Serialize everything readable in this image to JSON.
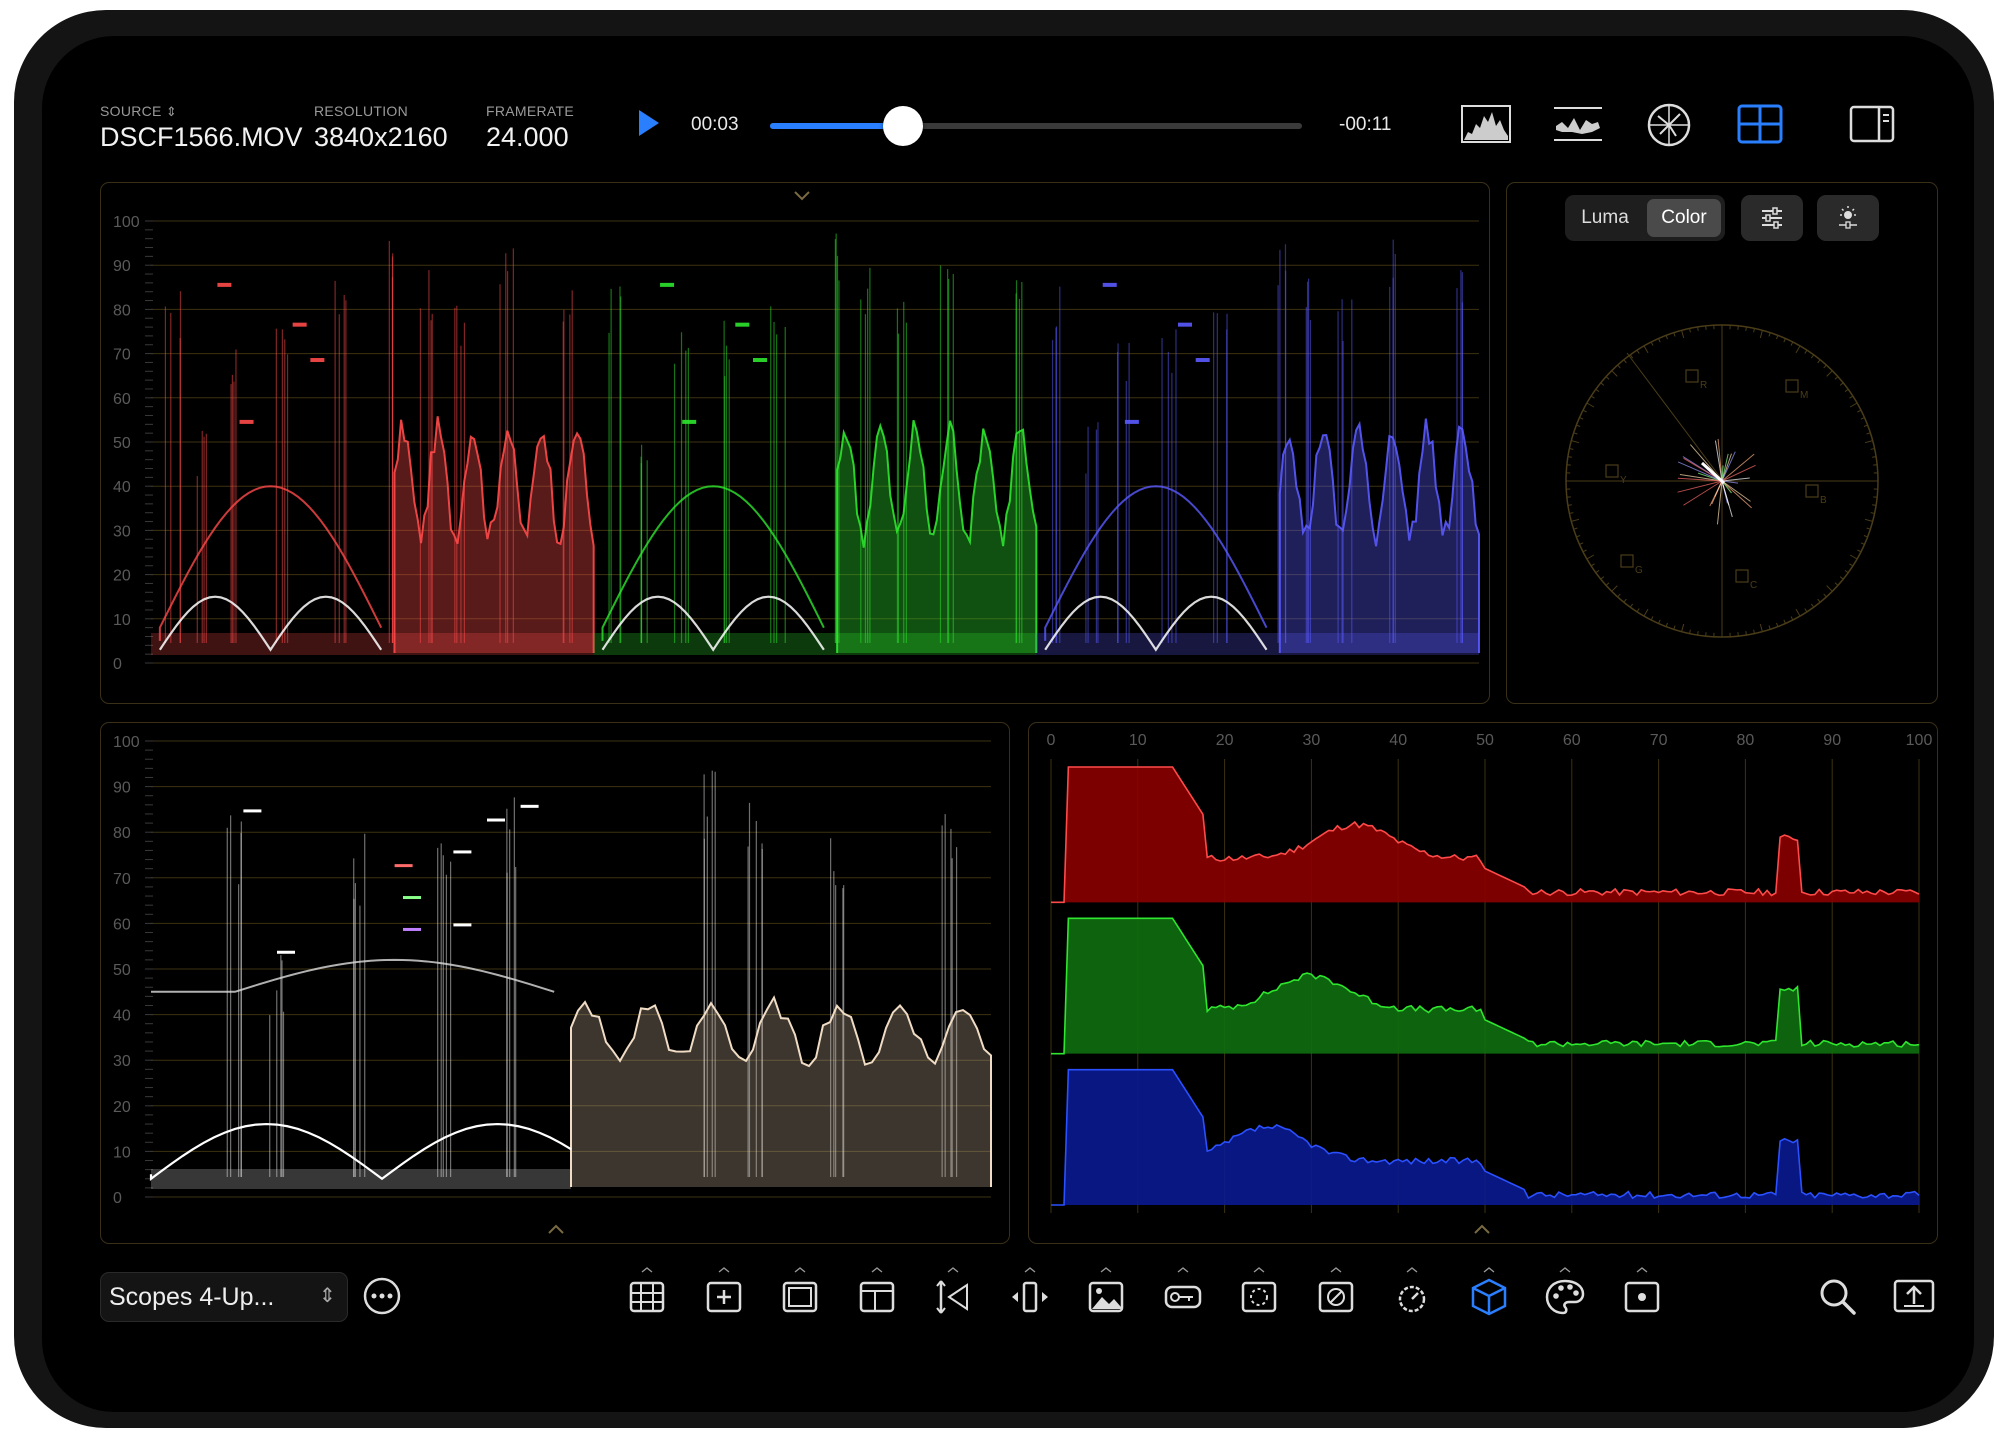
{
  "header": {
    "source_label": "SOURCE",
    "source_value": "DSCF1566.MOV",
    "resolution_label": "RESOLUTION",
    "resolution_value": "3840x2160",
    "framerate_label": "FRAMERATE",
    "framerate_value": "24.000",
    "time_elapsed": "00:03",
    "time_remaining": "-00:11",
    "playback_progress": 0.25
  },
  "colors": {
    "accent": "#2a7fff",
    "panel_border": "#3a3018",
    "grid_line": "#3d3210",
    "red": "#ff4a4a",
    "green": "#2ee62e",
    "blue": "#5a5aff"
  },
  "header_icons": [
    "histogram-icon",
    "waveform-icon",
    "vectorscope-icon",
    "grid-layout-icon",
    "sidebar-icon"
  ],
  "parade": {
    "y_ticks": [
      "100",
      "90",
      "80",
      "70",
      "60",
      "50",
      "40",
      "30",
      "20",
      "10",
      "0"
    ]
  },
  "vectorscope": {
    "mode_luma": "Luma",
    "mode_color": "Color",
    "selected_mode": "Color",
    "targets": [
      "R",
      "M",
      "B",
      "C",
      "G",
      "Y"
    ]
  },
  "luma_waveform": {
    "y_ticks": [
      "100",
      "90",
      "80",
      "70",
      "60",
      "50",
      "40",
      "30",
      "20",
      "10",
      "0"
    ]
  },
  "histogram": {
    "x_ticks": [
      "0",
      "10",
      "20",
      "30",
      "40",
      "50",
      "60",
      "70",
      "80",
      "90",
      "100"
    ]
  },
  "footer": {
    "preset_label": "Scopes 4-Up...",
    "tools": [
      "grid-icon",
      "crosshair-box-icon",
      "frame-icon",
      "layout-icon",
      "split-compare-icon",
      "mirror-icon",
      "image-icon",
      "key-icon",
      "mask-icon",
      "disable-icon",
      "timer-icon",
      "cube-icon",
      "palette-icon",
      "target-icon"
    ],
    "active_tool": "cube-icon"
  }
}
